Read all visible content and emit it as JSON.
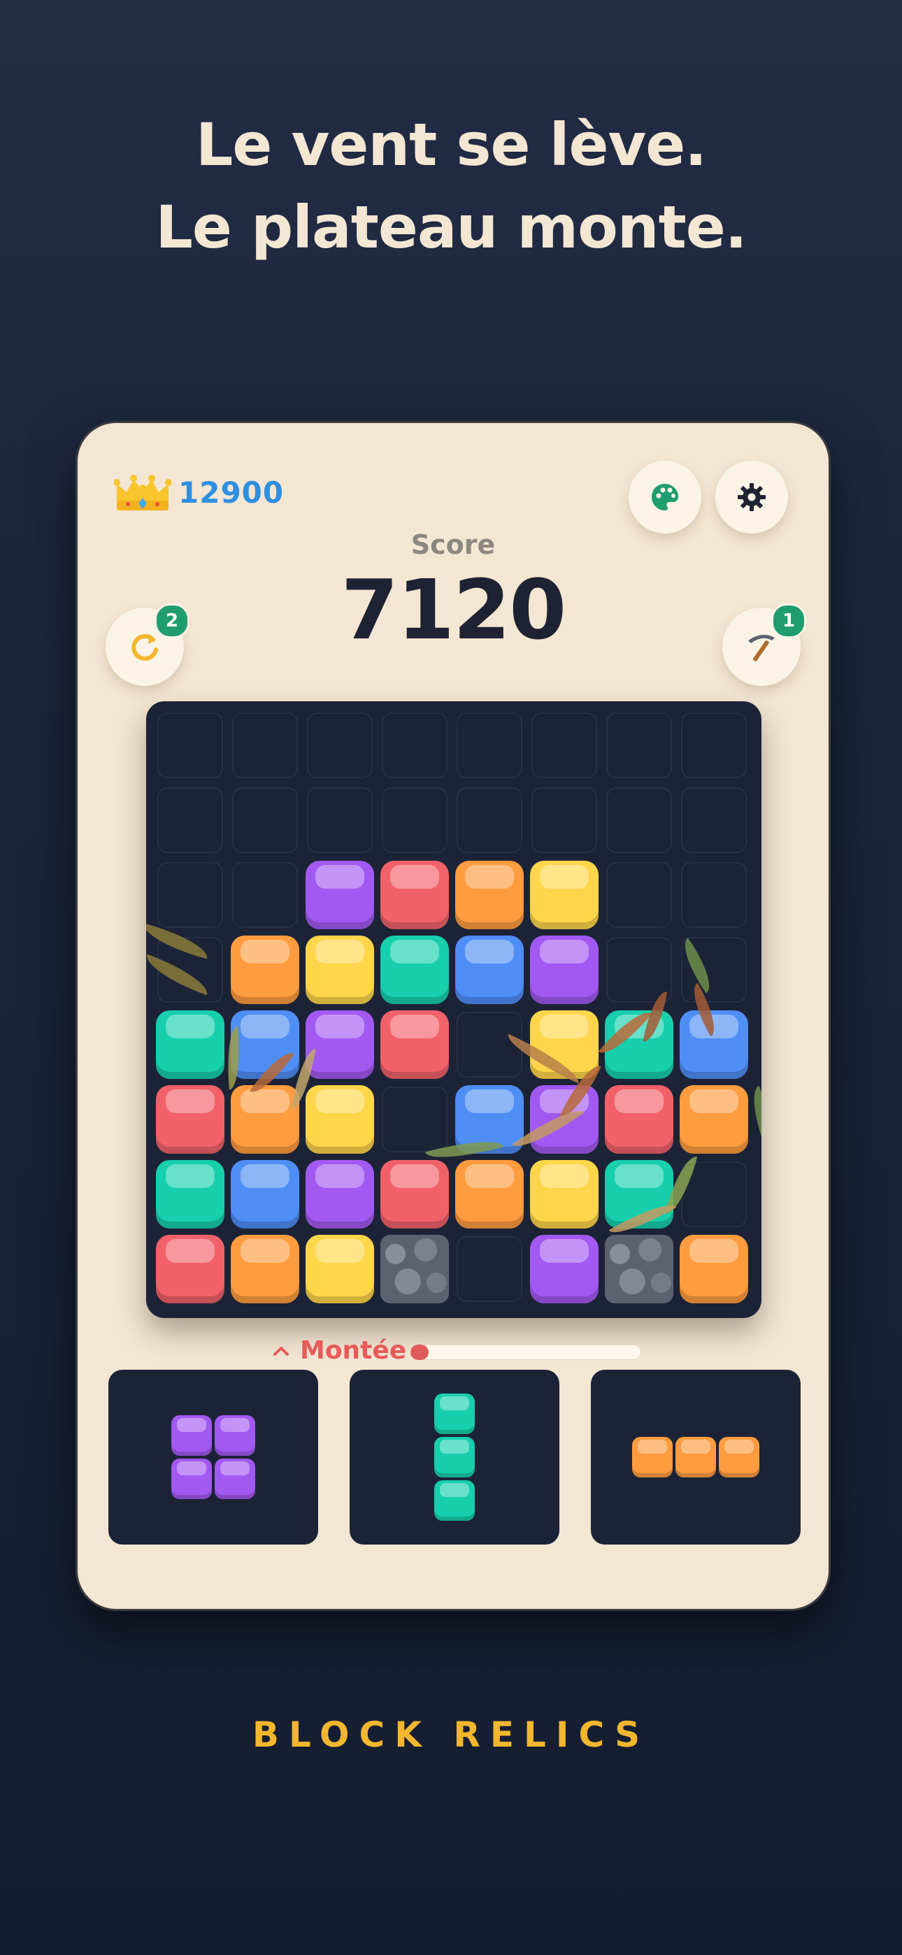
{
  "headline": {
    "line1": "Le vent se lève.",
    "line2": "Le plateau monte."
  },
  "game": {
    "best_score": "12900",
    "score_label": "Score",
    "score_value": "7120",
    "undo": {
      "icon": "undo-icon",
      "count": "2"
    },
    "hammer": {
      "icon": "pickaxe-icon",
      "count": "1"
    },
    "theme_button_icon": "palette-icon",
    "settings_button_icon": "gear-icon",
    "rise_label": "Montée",
    "rise_progress": 0.08
  },
  "colors": {
    "purple": "#a259f2",
    "red": "#f2616a",
    "orange": "#ff9c3f",
    "yellow": "#ffd64a",
    "teal": "#17cfad",
    "blue": "#4f8ef5",
    "stone": "#5e6270"
  },
  "board": {
    "cols": 8,
    "rows": [
      [
        "",
        "",
        "",
        "",
        "",
        "",
        "",
        ""
      ],
      [
        "",
        "",
        "",
        "",
        "",
        "",
        "",
        ""
      ],
      [
        "",
        "",
        "purple",
        "red",
        "orange",
        "yellow",
        "",
        ""
      ],
      [
        "",
        "orange",
        "yellow",
        "teal",
        "blue",
        "purple",
        "",
        ""
      ],
      [
        "teal",
        "blue",
        "purple",
        "red",
        "",
        "yellow",
        "teal",
        "blue"
      ],
      [
        "red",
        "orange",
        "yellow",
        "",
        "blue",
        "purple",
        "red",
        "orange"
      ],
      [
        "teal",
        "blue",
        "purple",
        "red",
        "orange",
        "yellow",
        "teal",
        ""
      ],
      [
        "red",
        "orange",
        "yellow",
        "stone",
        "",
        "purple",
        "stone",
        "orange"
      ]
    ]
  },
  "pieces": [
    {
      "color": "purple",
      "cells": [
        [
          0,
          0
        ],
        [
          1,
          0
        ],
        [
          0,
          1
        ],
        [
          1,
          1
        ]
      ]
    },
    {
      "color": "teal",
      "cells": [
        [
          0,
          0
        ],
        [
          0,
          1
        ],
        [
          0,
          2
        ]
      ]
    },
    {
      "color": "orange",
      "cells": [
        [
          0,
          0
        ],
        [
          1,
          0
        ],
        [
          2,
          0
        ]
      ]
    }
  ],
  "brand": "BLOCK RELICS"
}
